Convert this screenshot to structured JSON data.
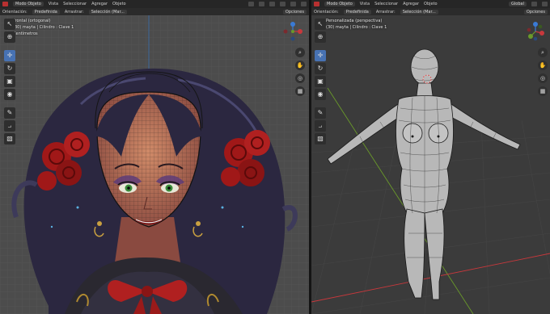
{
  "left": {
    "header": {
      "mode": "Modo Objeto",
      "view": "Vista",
      "select": "Seleccionar",
      "add": "Agregar",
      "object": "Objeto",
      "options": "Opciones"
    },
    "header2": {
      "orientation_label": "Orientación:",
      "orientation_value": "Predefinida",
      "drag_label": "Arrastrar:",
      "drag_value": "Selección (Mar..."
    },
    "overlay": {
      "view_name": "Frontal (ortogonal)",
      "object_info": "(30) mayta | Cilindro : Clave 1",
      "units": "Centímetros"
    }
  },
  "right": {
    "header": {
      "mode": "Modo Objeto",
      "view": "Vista",
      "select": "Seleccionar",
      "add": "Agregar",
      "object": "Objeto",
      "global": "Global",
      "options": "Opciones"
    },
    "header2": {
      "orientation_label": "Orientación:",
      "orientation_value": "Predefinida",
      "drag_label": "Arrastrar:",
      "drag_value": "Selección (Mar..."
    },
    "overlay": {
      "view_name": "Personalizada (perspectiva)",
      "object_info": "(30) mayta | Cilindro : Clave 1"
    }
  },
  "colors": {
    "accent": "#4772b3",
    "red_axis": "#c8383c",
    "green_axis": "#6a9a2a",
    "blue_axis": "#3a7bd5",
    "grid_left": "#555555",
    "grid_right": "#444444"
  },
  "icons": {
    "cursor": "select-cursor-icon",
    "move": "move-icon",
    "rotate": "rotate-icon",
    "scale": "scale-icon",
    "transform": "transform-icon",
    "annotate": "annotate-icon",
    "measure": "measure-icon",
    "add_cube": "add-cube-icon"
  }
}
